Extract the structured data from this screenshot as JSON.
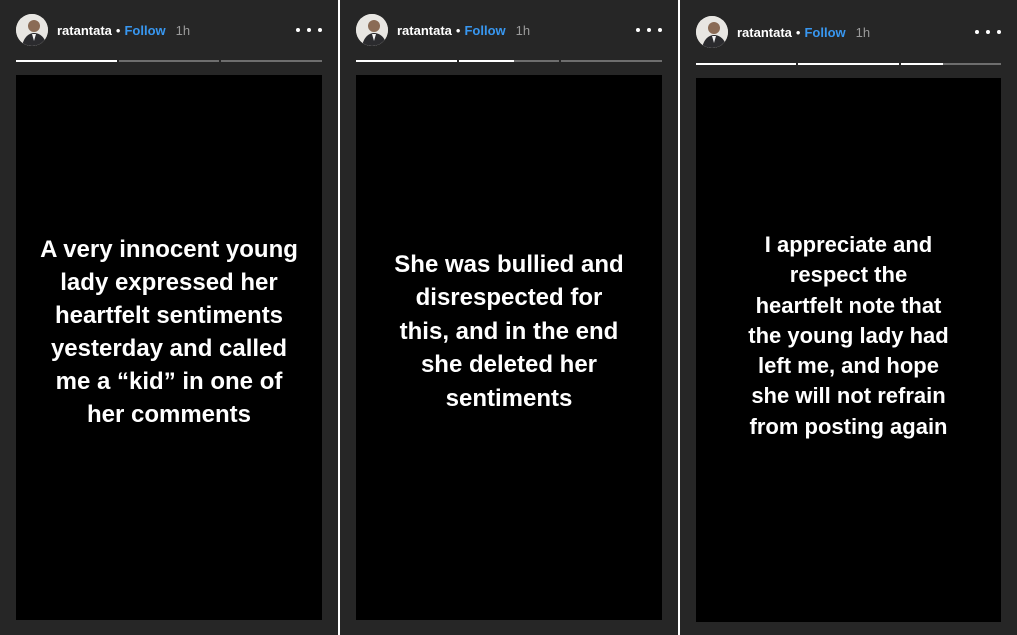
{
  "panels": [
    {
      "username": "ratantata",
      "separator": "•",
      "follow_label": "Follow",
      "time": "1h",
      "more_icon": "more-horizontal-icon",
      "progress": [
        1.0,
        0.0,
        0.0
      ],
      "story_text": "A very innocent young\nlady expressed her\nheartfelt sentiments\nyesterday and called\nme a “kid” in one of\nher comments"
    },
    {
      "username": "ratantata",
      "separator": "•",
      "follow_label": "Follow",
      "time": "1h",
      "more_icon": "more-horizontal-icon",
      "progress": [
        1.0,
        0.55,
        0.0
      ],
      "story_text": "She was bullied and\ndisrespected for\nthis, and in the end\nshe deleted her\nsentiments"
    },
    {
      "username": "ratantata",
      "separator": "•",
      "follow_label": "Follow",
      "time": "1h",
      "more_icon": "more-horizontal-icon",
      "progress": [
        1.0,
        1.0,
        0.42
      ],
      "story_text": "I appreciate and\nrespect the\nheartfelt note that\nthe young lady had\nleft me, and hope\nshe will not refrain\nfrom posting again"
    }
  ],
  "colors": {
    "panel_background": "#262626",
    "story_background": "#000000",
    "follow": "#3897f0",
    "progress_track": "#6e6e6e",
    "progress_fill": "#ffffff"
  }
}
